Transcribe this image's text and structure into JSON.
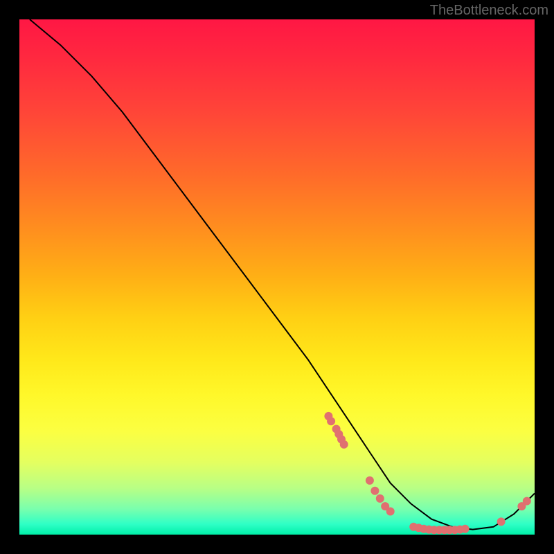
{
  "watermark": "TheBottleneck.com",
  "chart_data": {
    "type": "line",
    "title": "",
    "xlabel": "",
    "ylabel": "",
    "xlim": [
      0,
      100
    ],
    "ylim": [
      0,
      100
    ],
    "grid": false,
    "series": [
      {
        "name": "curve",
        "x": [
          2,
          8,
          14,
          20,
          26,
          32,
          38,
          44,
          50,
          56,
          60,
          64,
          68,
          72,
          76,
          80,
          84,
          88,
          92,
          96,
          100
        ],
        "y": [
          100,
          95,
          89,
          82,
          74,
          66,
          58,
          50,
          42,
          34,
          28,
          22,
          16,
          10,
          6,
          3,
          1.5,
          1,
          1.5,
          4,
          8
        ]
      }
    ],
    "markers": [
      {
        "x": 60.0,
        "y": 23.0
      },
      {
        "x": 60.5,
        "y": 22.0
      },
      {
        "x": 61.5,
        "y": 20.5
      },
      {
        "x": 62.0,
        "y": 19.5
      },
      {
        "x": 62.5,
        "y": 18.5
      },
      {
        "x": 63.0,
        "y": 17.5
      },
      {
        "x": 68.0,
        "y": 10.5
      },
      {
        "x": 69.0,
        "y": 8.5
      },
      {
        "x": 70.0,
        "y": 7.0
      },
      {
        "x": 71.0,
        "y": 5.5
      },
      {
        "x": 72.0,
        "y": 4.5
      },
      {
        "x": 76.5,
        "y": 1.5
      },
      {
        "x": 77.5,
        "y": 1.3
      },
      {
        "x": 78.5,
        "y": 1.1
      },
      {
        "x": 79.5,
        "y": 1.0
      },
      {
        "x": 80.5,
        "y": 0.9
      },
      {
        "x": 81.5,
        "y": 0.9
      },
      {
        "x": 82.5,
        "y": 0.9
      },
      {
        "x": 83.5,
        "y": 0.9
      },
      {
        "x": 84.5,
        "y": 0.9
      },
      {
        "x": 85.5,
        "y": 1.0
      },
      {
        "x": 86.5,
        "y": 1.1
      },
      {
        "x": 93.5,
        "y": 2.5
      },
      {
        "x": 97.5,
        "y": 5.5
      },
      {
        "x": 98.5,
        "y": 6.5
      }
    ],
    "marker_color": "#e07070",
    "line_color": "#000000"
  }
}
